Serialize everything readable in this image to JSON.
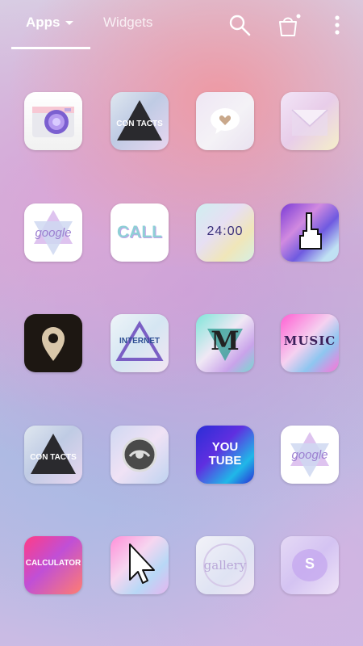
{
  "topbar": {
    "tabs": [
      {
        "label": "Apps",
        "selected": true
      },
      {
        "label": "Widgets",
        "selected": false
      }
    ],
    "actions": [
      "search-icon",
      "shopping-bag-icon",
      "more-vertical-icon"
    ]
  },
  "apps": [
    {
      "name": "camera",
      "label": ""
    },
    {
      "name": "contacts",
      "label": "CON TACTS"
    },
    {
      "name": "messages",
      "label": ""
    },
    {
      "name": "email",
      "label": ""
    },
    {
      "name": "google",
      "label": "google"
    },
    {
      "name": "call",
      "label": "CALL"
    },
    {
      "name": "clock",
      "label": "24:00"
    },
    {
      "name": "pointer",
      "label": ""
    },
    {
      "name": "maps",
      "label": ""
    },
    {
      "name": "internet",
      "label": "INTERNET"
    },
    {
      "name": "m",
      "label": "M"
    },
    {
      "name": "music",
      "label": "MUSIC"
    },
    {
      "name": "contacts-2",
      "label": "CON TACTS"
    },
    {
      "name": "settings",
      "label": ""
    },
    {
      "name": "youtube",
      "label": "YOU TUBE"
    },
    {
      "name": "google-2",
      "label": "google"
    },
    {
      "name": "calculator",
      "label": "CALCULATOR"
    },
    {
      "name": "cursor",
      "label": ""
    },
    {
      "name": "gallery",
      "label": "gallery"
    },
    {
      "name": "s-app",
      "label": "S"
    }
  ]
}
